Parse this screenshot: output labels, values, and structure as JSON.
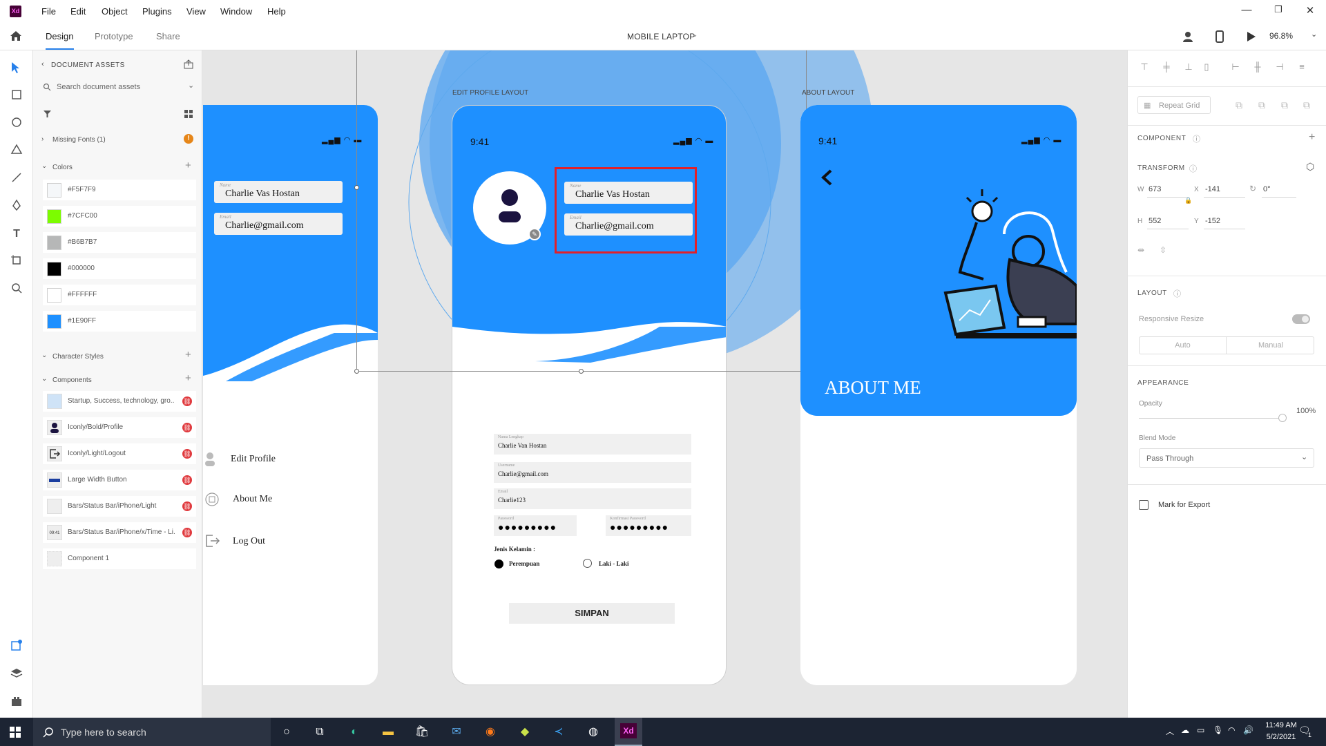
{
  "app": {
    "logo": "Xd",
    "menu": [
      "File",
      "Edit",
      "Object",
      "Plugins",
      "View",
      "Window",
      "Help"
    ],
    "tabs": [
      "Design",
      "Prototype",
      "Share"
    ],
    "doc_title": "MOBILE LAPTOP",
    "zoom": "96.8%"
  },
  "assets": {
    "title": "DOCUMENT ASSETS",
    "search_placeholder": "Search document assets",
    "missing_fonts": "Missing Fonts (1)",
    "colors_label": "Colors",
    "colors": [
      {
        "label": "#F5F7F9",
        "hex": "#F5F7F9"
      },
      {
        "label": "#7CFC00",
        "hex": "#7CFC00"
      },
      {
        "label": "#B6B7B7",
        "hex": "#B6B7B7"
      },
      {
        "label": "#000000",
        "hex": "#000000"
      },
      {
        "label": "#FFFFFF",
        "hex": "#FFFFFF"
      },
      {
        "label": "#1E90FF",
        "hex": "#1E90FF"
      }
    ],
    "char_styles_label": "Character Styles",
    "components_label": "Components",
    "components": [
      "Startup, Success, technology, gro...",
      "Iconly/Bold/Profile",
      "Iconly/Light/Logout",
      "Large Width Button",
      "Bars/Status Bar/iPhone/Light",
      "Bars/Status Bar/iPhone/x/Time - Li...",
      "Component 1"
    ]
  },
  "canvas": {
    "left_artboard": {
      "name_caption": "Name",
      "name_value": "Charlie Vas Hostan",
      "email_caption": "Email",
      "email_value": "Charlie@gmail.com",
      "menu": [
        "Edit Profile",
        "About Me",
        "Log Out"
      ]
    },
    "edit_profile": {
      "title": "EDIT PROFILE LAYOUT",
      "time": "9:41",
      "name_caption": "Name",
      "name_value": "Charlie Vas Hostan",
      "email_caption": "Email",
      "email_value": "Charlie@gmail.com",
      "fields": [
        {
          "caption": "Nama Lengkap",
          "value": "Charlie Van Hostan"
        },
        {
          "caption": "Username",
          "value": "Charlie@gmail.com"
        },
        {
          "caption": "Email",
          "value": "Charlie123"
        }
      ],
      "password_caption": "Password",
      "confirm_caption": "Konfirmasi Password",
      "password_dots": "●●●●●●●●●",
      "gender_label": "Jenis Kelamin :",
      "gender_female": "Perempuan",
      "gender_male": "Laki - Laki",
      "save_label": "SIMPAN"
    },
    "about": {
      "title": "ABOUT LAYOUT",
      "time": "9:41",
      "heading": "ABOUT ME"
    },
    "blue": "#1E90FF",
    "highlight": "#e0202a"
  },
  "props": {
    "repeat_grid": "Repeat Grid",
    "component": "COMPONENT",
    "transform": "TRANSFORM",
    "w_label": "W",
    "w": "673",
    "x_label": "X",
    "x": "-141",
    "rot": "0°",
    "h_label": "H",
    "h": "552",
    "y_label": "Y",
    "y": "-152",
    "layout": "LAYOUT",
    "responsive": "Responsive Resize",
    "auto": "Auto",
    "manual": "Manual",
    "appearance": "APPEARANCE",
    "opacity_label": "Opacity",
    "opacity": "100%",
    "blend_label": "Blend Mode",
    "blend": "Pass Through",
    "export": "Mark for Export"
  },
  "taskbar": {
    "search": "Type here to search",
    "time": "11:49 AM",
    "date": "5/2/2021",
    "notif_count": "1"
  }
}
